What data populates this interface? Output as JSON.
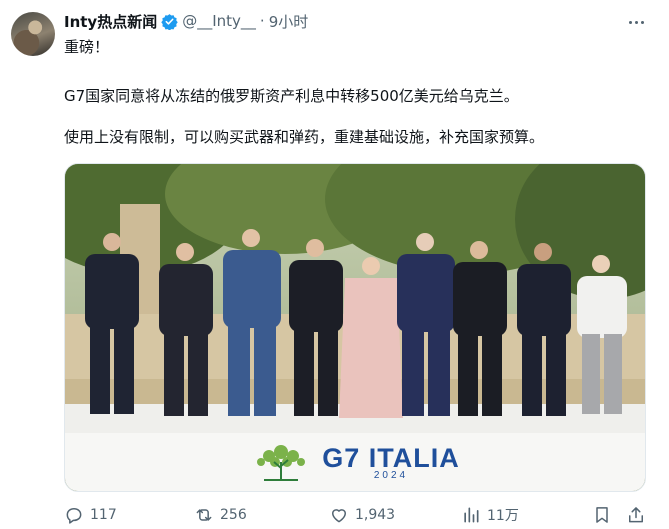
{
  "tweet": {
    "display_name": "Inty热点新闻",
    "handle": "@__Inty__",
    "separator": "·",
    "time": "9小时",
    "lines": [
      "重磅！",
      "G7国家同意将从冻结的俄罗斯资产利息中转移500亿美元给乌克兰。",
      "使用上没有限制，可以购买武器和弹药，重建基础设施，补充国家预算。"
    ]
  },
  "photo": {
    "banner_text": "G7 ITALIA",
    "banner_year": "2024",
    "colors": {
      "sky": "#b9c6a4",
      "trees": "#5f7a3c",
      "wall": "#d2c2a0",
      "floor": "#f3f3f0",
      "brand": "#1f4f9b"
    }
  },
  "actions": {
    "reply_count": "117",
    "retweet_count": "256",
    "like_count": "1,943",
    "views_count": "11万"
  },
  "icons": {
    "verified": "verified-badge-icon",
    "more": "more-icon",
    "reply": "reply-icon",
    "retweet": "retweet-icon",
    "like": "like-icon",
    "views": "views-icon",
    "bookmark": "bookmark-icon",
    "share": "share-icon"
  }
}
